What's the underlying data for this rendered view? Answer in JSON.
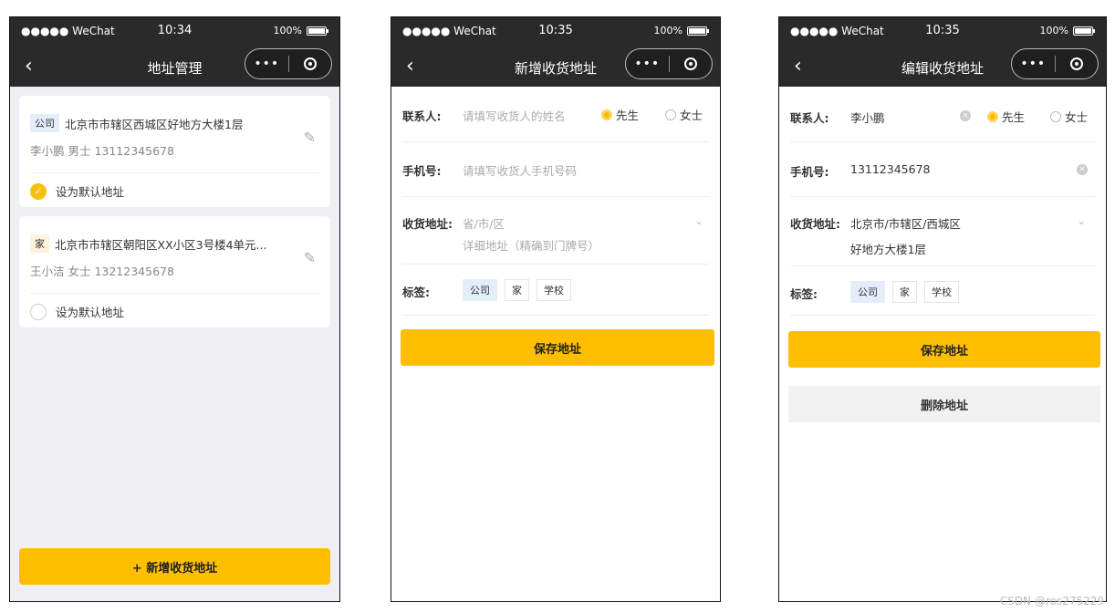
{
  "status": {
    "carrier": "●●●●● WeChat",
    "wifi": "ᯤ",
    "battery_text": "100%",
    "time_list": "10:34",
    "time_form": "10:35"
  },
  "icons": {
    "back": "‹",
    "edit": "✎",
    "more": "•••",
    "check": "✓",
    "clear": "×",
    "chevron": "⌄"
  },
  "list_page": {
    "title": "地址管理",
    "addresses": [
      {
        "tag": "公司",
        "address": "北京市市辖区西城区好地方大楼1层",
        "person": "李小鹏 男士  13112345678",
        "default_label": "设为默认地址",
        "is_default": true
      },
      {
        "tag": "家",
        "address": "北京市市辖区朝阳区XX小区3号楼4单元...",
        "person": "王小洁 女士  13212345678",
        "default_label": "设为默认地址",
        "is_default": false
      }
    ],
    "add_button": "+ 新增收货地址"
  },
  "new_page": {
    "title": "新增收货地址",
    "contact_label": "联系人:",
    "contact_placeholder": "请填写收货人的姓名",
    "gender_male": "先生",
    "gender_female": "女士",
    "phone_label": "手机号:",
    "phone_placeholder": "请填写收货人手机号码",
    "address_label": "收货地址:",
    "region_placeholder": "省/市/区",
    "detail_placeholder": "详细地址（精确到门牌号）",
    "tags_label": "标签:",
    "tags": [
      "公司",
      "家",
      "学校"
    ],
    "selected_tag": "公司",
    "save_button": "保存地址"
  },
  "edit_page": {
    "title": "编辑收货地址",
    "contact_label": "联系人:",
    "contact_value": "李小鹏",
    "gender_male": "先生",
    "gender_female": "女士",
    "phone_label": "手机号:",
    "phone_value": "13112345678",
    "address_label": "收货地址:",
    "region_value": "北京市/市辖区/西城区",
    "detail_value": "好地方大楼1层",
    "tags_label": "标签:",
    "tags": [
      "公司",
      "家",
      "学校"
    ],
    "selected_tag": "公司",
    "save_button": "保存地址",
    "delete_button": "删除地址"
  },
  "watermark": "CSDN @ros275229",
  "colors": {
    "accent": "#ffbf00",
    "navbar": "#2a2a2a",
    "list_bg": "#efeff3"
  }
}
